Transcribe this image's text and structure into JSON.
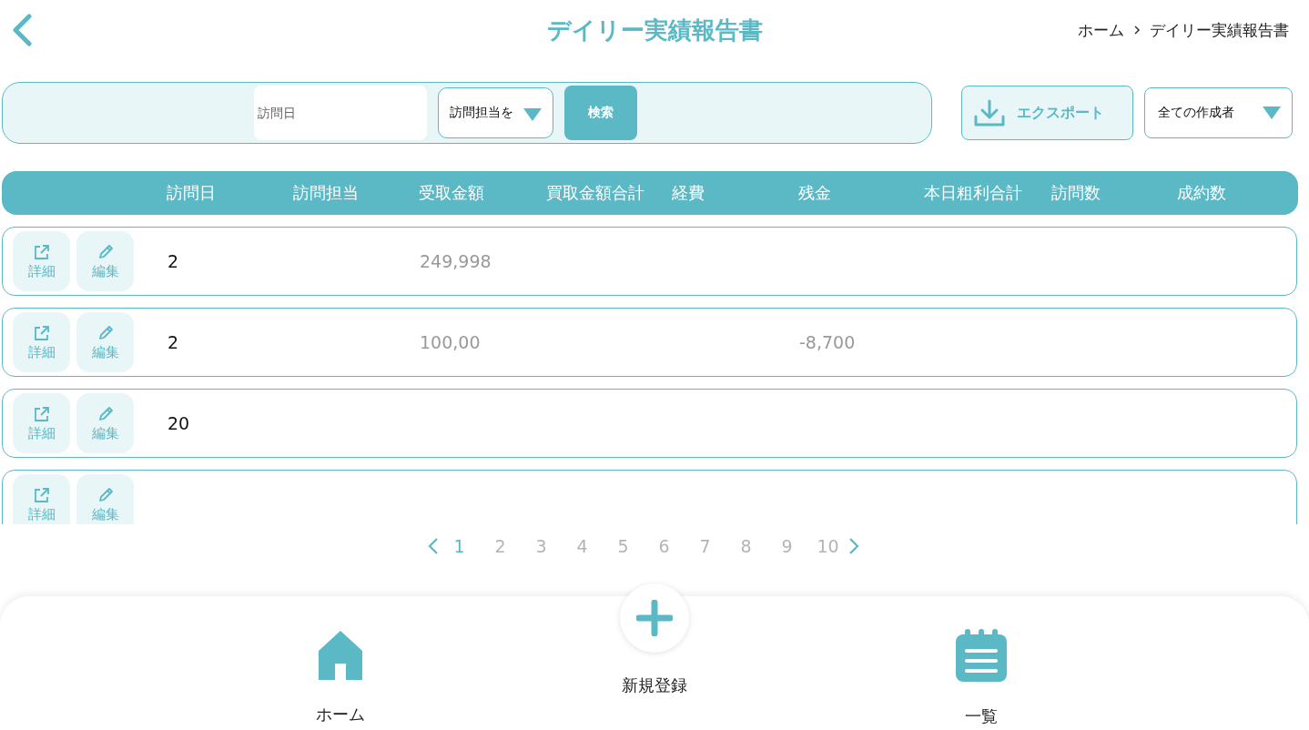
{
  "header": {
    "title": "デイリー実績報告書",
    "breadcrumb": [
      "ホーム",
      "デイリー実績報告書"
    ]
  },
  "search": {
    "date_placeholder": "訪問日",
    "staff_select": "訪問担当を",
    "search_button": "検索"
  },
  "export_button": "エクスポート",
  "author_select": "全ての作成者",
  "table": {
    "columns": [
      "訪問日",
      "訪問担当",
      "受取金額",
      "買取金額合計",
      "経費",
      "残金",
      "本日粗利合計",
      "訪問数",
      "成約数"
    ],
    "rows": [
      {
        "actions": [
          "詳細",
          "編集"
        ],
        "cells": [
          "2",
          null,
          "249,998",
          null,
          null,
          null,
          null,
          null,
          null
        ]
      },
      {
        "actions": [
          "詳細",
          "編集"
        ],
        "cells": [
          "2",
          null,
          "100,00",
          null,
          null,
          "-8,700",
          null,
          null,
          null
        ]
      },
      {
        "actions": [
          "詳細",
          "編集"
        ],
        "cells": [
          "20",
          null,
          null,
          null,
          null,
          null,
          null,
          null,
          null
        ]
      },
      {
        "actions": [
          "詳細",
          "編集"
        ],
        "cells": [
          null,
          null,
          null,
          null,
          null,
          null,
          null,
          null,
          null
        ]
      }
    ]
  },
  "pagination": {
    "pages": [
      {
        "label": "1",
        "selected": true
      },
      {
        "label": "2",
        "selected": false
      },
      {
        "label": "3",
        "selected": false
      },
      {
        "label": "4",
        "selected": false
      },
      {
        "label": "5",
        "selected": false
      },
      {
        "label": "6",
        "selected": false
      },
      {
        "label": "7",
        "selected": false
      },
      {
        "label": "8",
        "selected": false
      },
      {
        "label": "9",
        "selected": false
      },
      {
        "label": "10",
        "selected": false
      }
    ]
  },
  "bottom_nav": [
    {
      "kind": "home",
      "label": "ホーム"
    },
    {
      "kind": "add",
      "label": "新規登録"
    },
    {
      "kind": "list",
      "label": "一覧"
    }
  ]
}
